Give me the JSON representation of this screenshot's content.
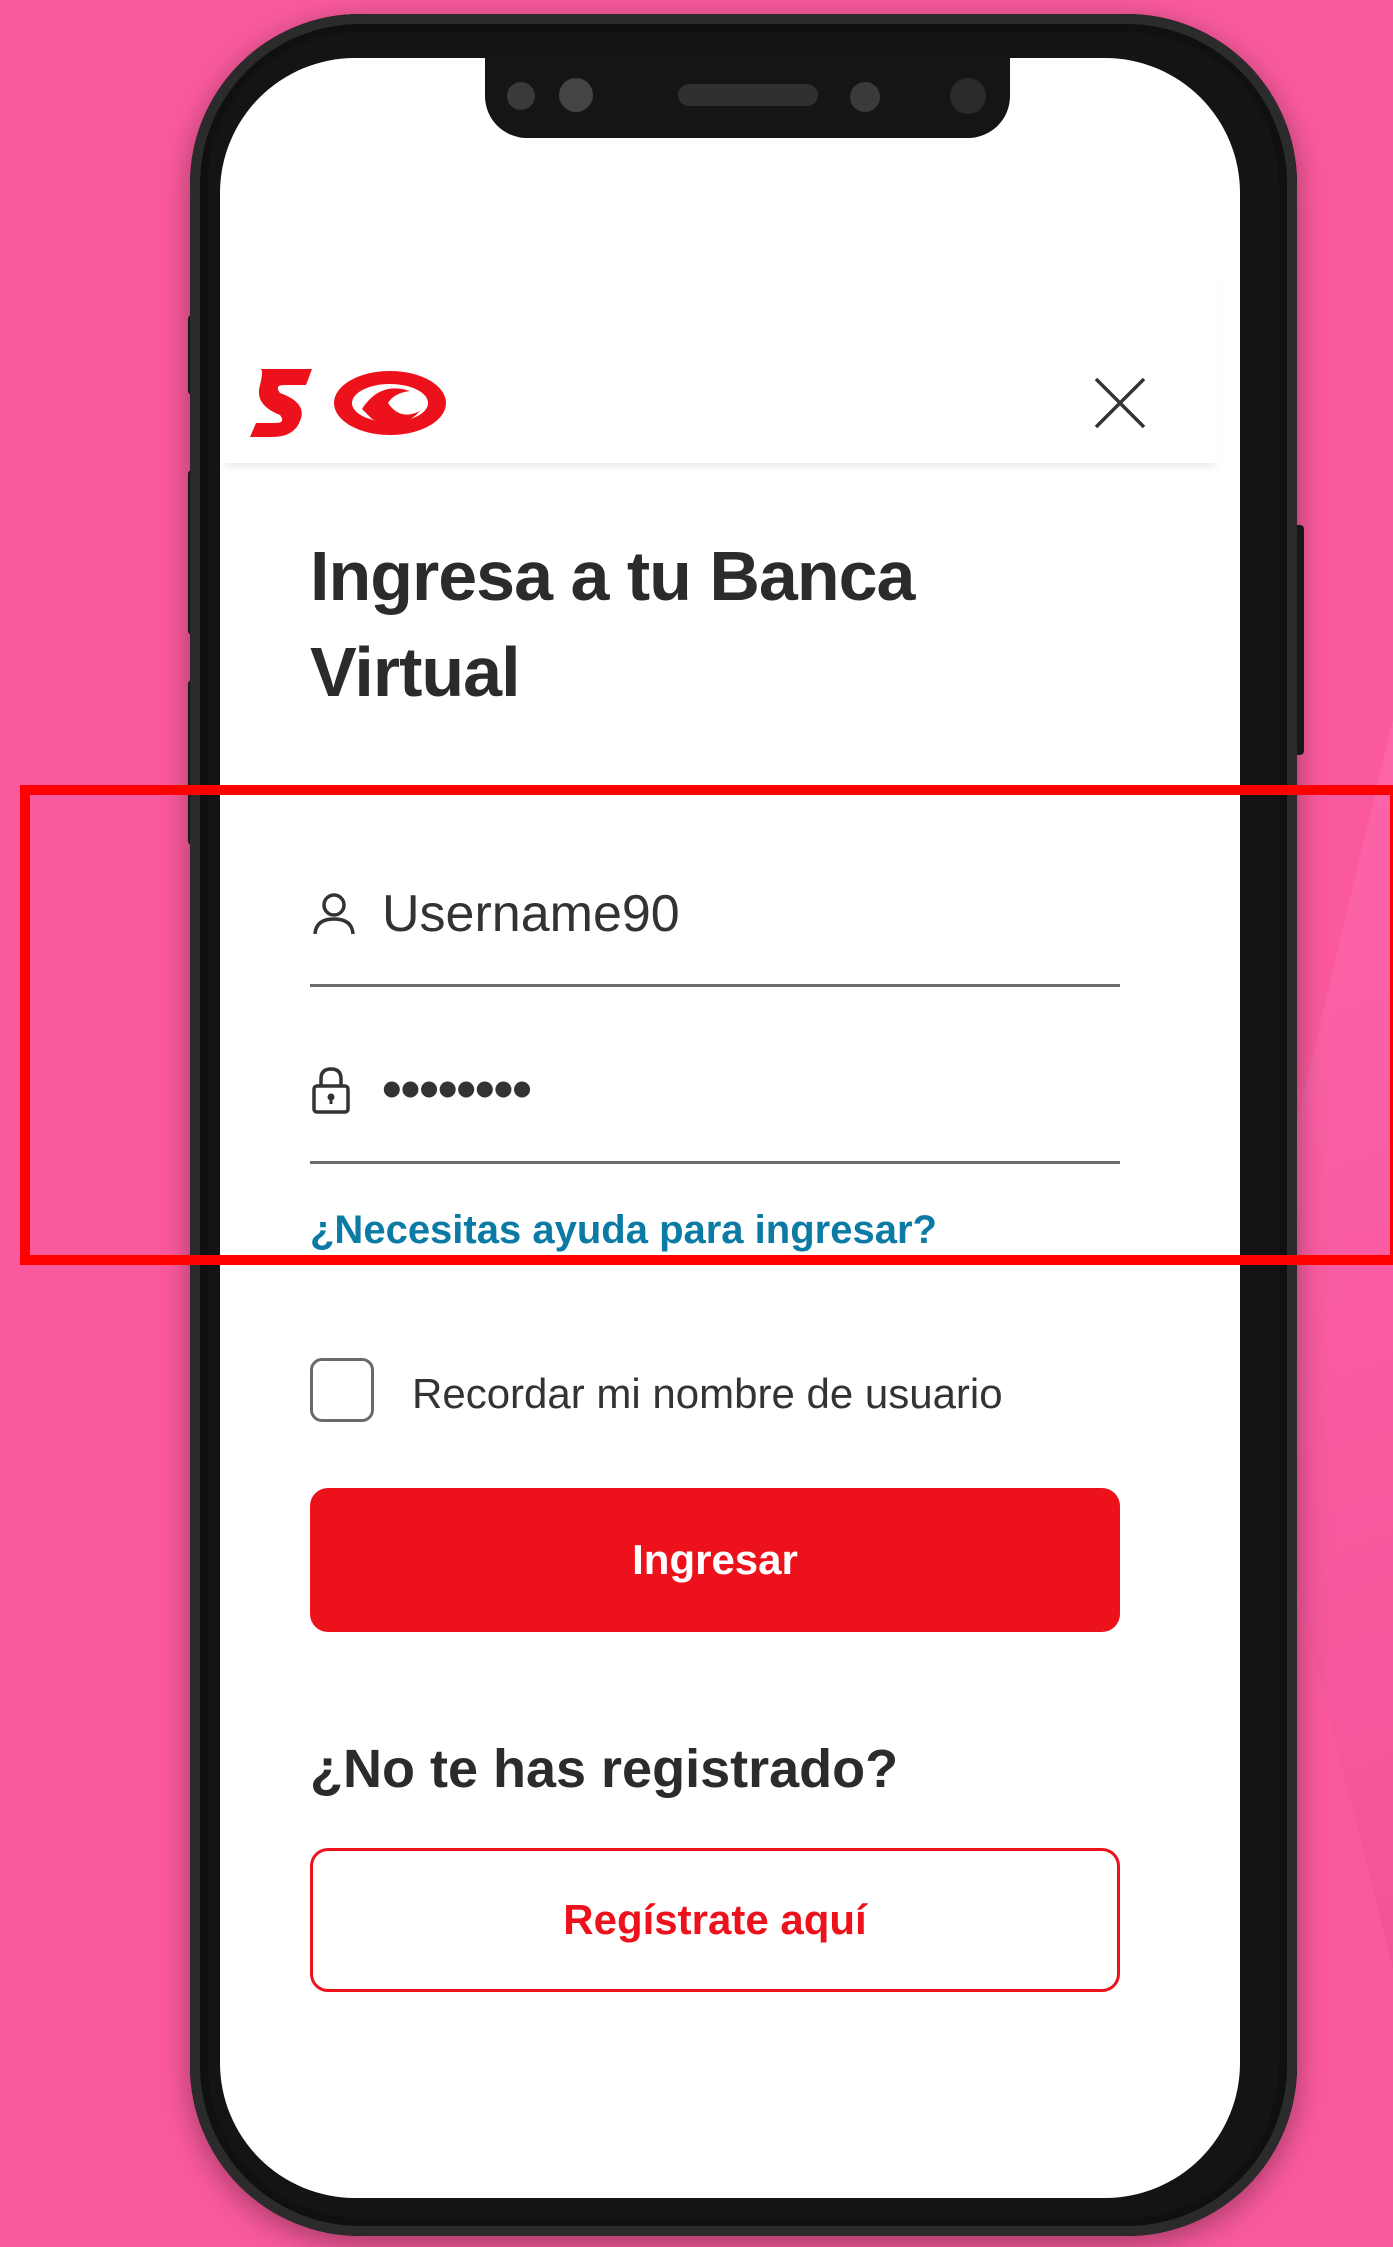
{
  "header": {
    "logo_icon": "scotiabank-logo-icon",
    "close_icon": "close-icon",
    "brand_color": "#ec111a"
  },
  "login": {
    "title": "Ingresa a tu Banca Virtual",
    "username": {
      "icon": "user-icon",
      "value": "Username90"
    },
    "password": {
      "icon": "lock-icon",
      "value": "••••••••"
    },
    "help_link": "¿Necesitas ayuda para ingresar?",
    "remember_label": "Recordar mi nombre de usuario",
    "remember_checked": false,
    "submit_label": "Ingresar"
  },
  "register": {
    "heading": "¿No te has registrado?",
    "button_label": "Regístrate aquí"
  },
  "colors": {
    "background": "#fa5a9d",
    "link": "#0b7ba6",
    "highlight": "#ff0000"
  }
}
